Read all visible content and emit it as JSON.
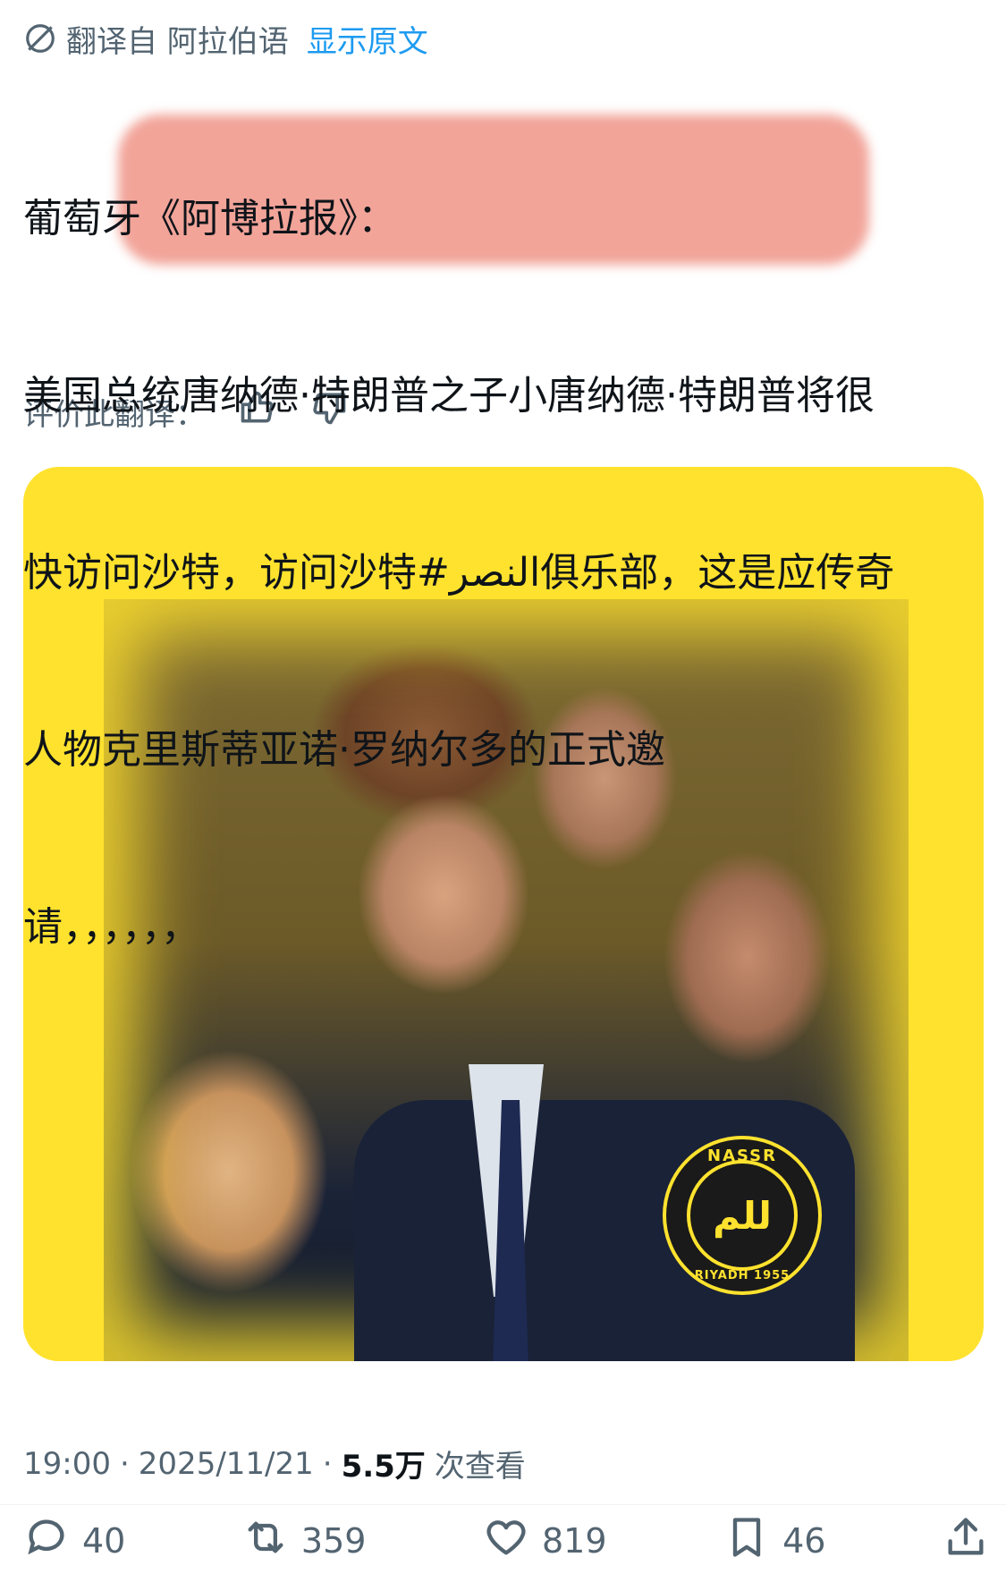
{
  "translation": {
    "label": "翻译自 阿拉伯语",
    "show_original": "显示原文"
  },
  "tweet": {
    "lines": [
      "葡萄牙《阿博拉报》：",
      "美国总统唐纳德·特朗普之子小唐纳德·特朗普将很",
      "快访问沙特，访问沙特#النصر俱乐部，这是应传奇",
      "人物克里斯蒂亚诺·罗纳尔多的正式邀",
      "请，，，，，，"
    ],
    "rate_label": "评价此翻译："
  },
  "media": {
    "badge_top": "NASSR",
    "badge_center": "ﻟﻠﻢ",
    "badge_bottom": "RIYADH 1955"
  },
  "meta": {
    "time": "19:00",
    "separator": "·",
    "date": "2025/11/21",
    "views_count": "5.5万",
    "views_label": "次查看"
  },
  "actions": {
    "replies": "40",
    "retweets": "359",
    "likes": "819",
    "bookmarks": "46"
  },
  "colors": {
    "link": "#1d9bf0",
    "muted": "#536471",
    "highlight": "#e85a46",
    "media_bg": "#ffe22e"
  }
}
